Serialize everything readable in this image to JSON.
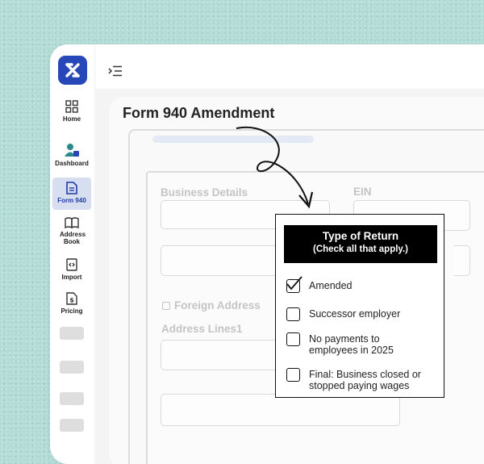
{
  "sidebar": {
    "items": [
      {
        "label": "Home",
        "icon": "grid-icon",
        "active": false
      },
      {
        "label": "Dashboard",
        "icon": "user-icon",
        "active": false
      },
      {
        "label": "Form 940",
        "icon": "document-icon",
        "active": true
      },
      {
        "label": "Address Book",
        "icon": "book-icon",
        "active": false
      },
      {
        "label": "Import",
        "icon": "import-icon",
        "active": false
      },
      {
        "label": "Pricing",
        "icon": "pricing-icon",
        "active": false
      }
    ]
  },
  "header": {
    "menu_icon": "menu-indent-icon"
  },
  "form": {
    "title": "Form 940 Amendment",
    "business_details_label": "Business Details",
    "ein_label": "EIN",
    "foreign_address_label": "Foreign Address",
    "address_lines_label": "Address Lines1"
  },
  "popup": {
    "title": "Type of Return",
    "subtitle": "(Check all that apply.)",
    "options": [
      {
        "label": "Amended",
        "checked": true
      },
      {
        "label": "Successor employer",
        "checked": false
      },
      {
        "label": "No payments to employees in 2025",
        "checked": false
      },
      {
        "label": "Final: Business closed or stopped paying wages",
        "checked": false
      }
    ]
  },
  "colors": {
    "accent": "#2746b8",
    "active_bg": "#d7deef",
    "background": "#b3dcd6"
  }
}
